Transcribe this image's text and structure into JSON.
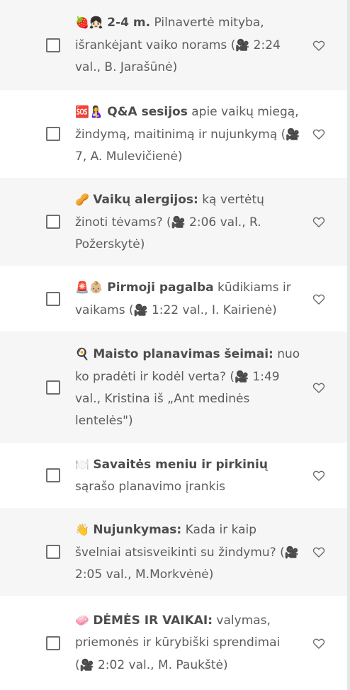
{
  "items": [
    {
      "emoji": "🍓👧🏻",
      "bold": "2-4 m.",
      "rest": " Pilnavertė mityba, išrankėjant vaiko norams (",
      "camera": "🎥",
      "tail": " 2:24 val., B. Jarašūnė)"
    },
    {
      "emoji": "🆘🤱",
      "bold": "Q&A sesijos",
      "rest": " apie vaikų miegą, žindymą, maitinimą ir nujunkymą (",
      "camera": "🎥",
      "tail": " 7, A. Mulevičienė)"
    },
    {
      "emoji": "🥜",
      "bold": "Vaikų alergijos:",
      "rest": " ką vertėtų žinoti tėvams? (",
      "camera": "🎥",
      "tail": " 2:06 val., R. Požerskytė)"
    },
    {
      "emoji": "🚨👶🏼",
      "bold": "Pirmoji pagalba",
      "rest": " kūdikiams ir vaikams (",
      "camera": "🎥",
      "tail": " 1:22 val., I. Kairienė)"
    },
    {
      "emoji": "🍳",
      "bold": "Maisto planavimas šeimai:",
      "rest": " nuo ko pradėti ir kodėl verta? (",
      "camera": "🎥",
      "tail": " 1:49 val., Kristina iš „Ant medinės lentelės\")"
    },
    {
      "emoji": "🍽️",
      "bold": "Savaitės meniu ir pirkinių",
      "rest": " sąrašo planavimo įrankis",
      "camera": "",
      "tail": ""
    },
    {
      "emoji": "👋",
      "bold": "Nujunkymas:",
      "rest": " Kada ir kaip švelniai atsisveikinti su žindymu? (",
      "camera": "🎥",
      "tail": " 2:05 val., M.Morkvėnė)"
    },
    {
      "emoji": "🧼",
      "bold": "DĖMĖS IR VAIKAI:",
      "rest": " valymas, priemonės ir kūrybiški sprendimai (",
      "camera": "🎥",
      "tail": " 2:02 val., M. Paukštė)"
    }
  ],
  "icons": {
    "checkbox": "checkbox-empty",
    "favorite": "heart-outline-icon"
  },
  "colors": {
    "row_alt": "#f6f6f6",
    "text": "#5c5c5c"
  }
}
